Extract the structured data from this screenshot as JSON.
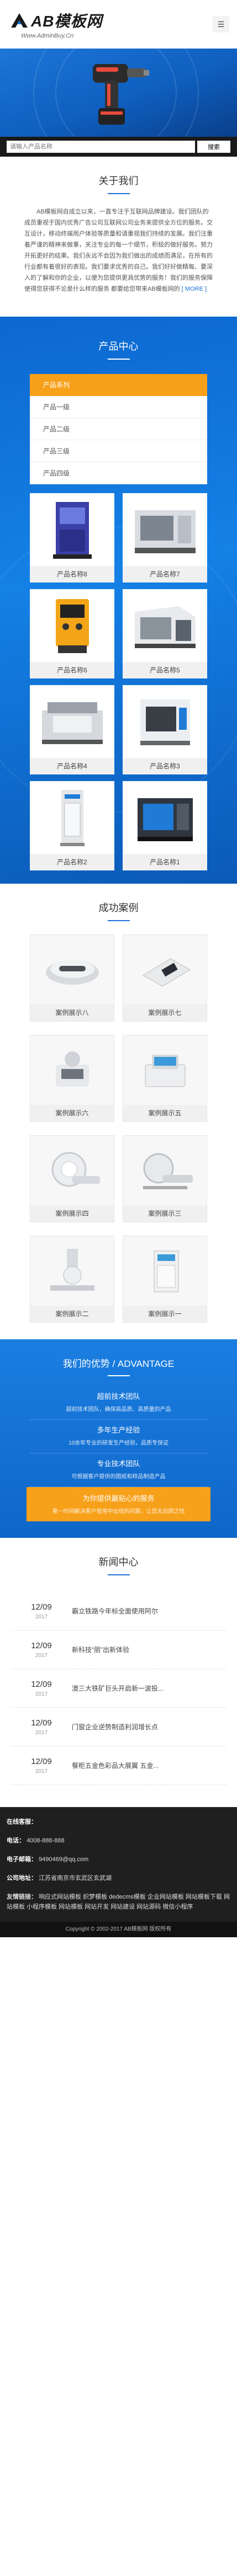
{
  "header": {
    "logo_text": "AB模板网",
    "logo_sub": "Www.AdminBuy.Cn",
    "menu_icon": "menu-icon"
  },
  "search": {
    "placeholder": "请输入产品名称",
    "button": "搜索"
  },
  "about": {
    "title": "关于我们",
    "text": "AB模板网自成立以来，一直专注于互联网品牌建设。我们团队的成员重视于国内优秀广告公司互联网公司业务来提供全方位的服务。交互设计，移动终端用户体验等质量和请重视我们持续的发展。我们注重着严谨的精神来做事，关注专业的每一个细节，积极的做好服务。努力开拓更好的结果。我们永远不会因为我们做出的成绩而满足，在所有的行业都有着很好的表现。我们要求优秀的自己。我们好好做精每、要深入的了解和你的企业，以便为您提供更具优势的服务！我们的服务保障使得您获得不论是什么样的服务 都要给您带来AB模板网的",
    "more": "[ MORE ]"
  },
  "products": {
    "title": "产品中心",
    "categories": [
      "产品系列",
      "产品一级",
      "产品二级",
      "产品三级",
      "产品四级"
    ],
    "items": [
      "产品名称8",
      "产品名称7",
      "产品名称6",
      "产品名称5",
      "产品名称4",
      "产品名称3",
      "产品名称2",
      "产品名称1"
    ]
  },
  "cases": {
    "title": "成功案例",
    "items": [
      "案例展示八",
      "案例展示七",
      "案例展示六",
      "案例展示五",
      "案例展示四",
      "案例展示三",
      "案例展示二",
      "案例展示一"
    ]
  },
  "advantage": {
    "title": "我们的优势 / ADVANTAGE",
    "items": [
      {
        "title": "超前技术团队",
        "desc": "超前技术团队，确保高品质、高质量的产品"
      },
      {
        "title": "多年生产经验",
        "desc": "10余年专业的研发生产经验，品质专保证"
      },
      {
        "title": "专业技术团队",
        "desc": "可根据客户提供的图纸和样品制造产品"
      },
      {
        "title": "为你提供最贴心的服务",
        "desc": "第一时间解决客户使用中出现的问题，让您无后顾之忧"
      }
    ]
  },
  "news": {
    "title": "新闻中心",
    "items": [
      {
        "day": "12/09",
        "year": "2017",
        "title": "霸立铁路今年标全面使用阿尔"
      },
      {
        "day": "12/09",
        "year": "2017",
        "title": "新科技“丽”出新体验"
      },
      {
        "day": "12/09",
        "year": "2017",
        "title": "澳三大铁矿巨头开启新一波投..."
      },
      {
        "day": "12/09",
        "year": "2017",
        "title": "门窗企业逆势制造利润增长点"
      },
      {
        "day": "12/09",
        "year": "2017",
        "title": "餐柜五金色彩品大展翼 五金..."
      }
    ]
  },
  "footer": {
    "address_label": "在线客服：",
    "address_value": "",
    "phone_label": "电话：",
    "phone_value": "4008-888-888",
    "email_label": "电子邮箱：",
    "email_value": "9490469@qq.com",
    "addr_label": "公司地址：",
    "addr_value": "江苏省南京市玄武区玄武湖",
    "links_label": "友情链接：",
    "links": "响应式网站模板  织梦模板  dedecms模板  企业网站模板  网站模板下载  网站模板  小程序模板  网站模板  网站开发  网站建设  网站源码  微信小程序",
    "copyright": "Copyright © 2002-2017 AB模板网 版权所有"
  }
}
